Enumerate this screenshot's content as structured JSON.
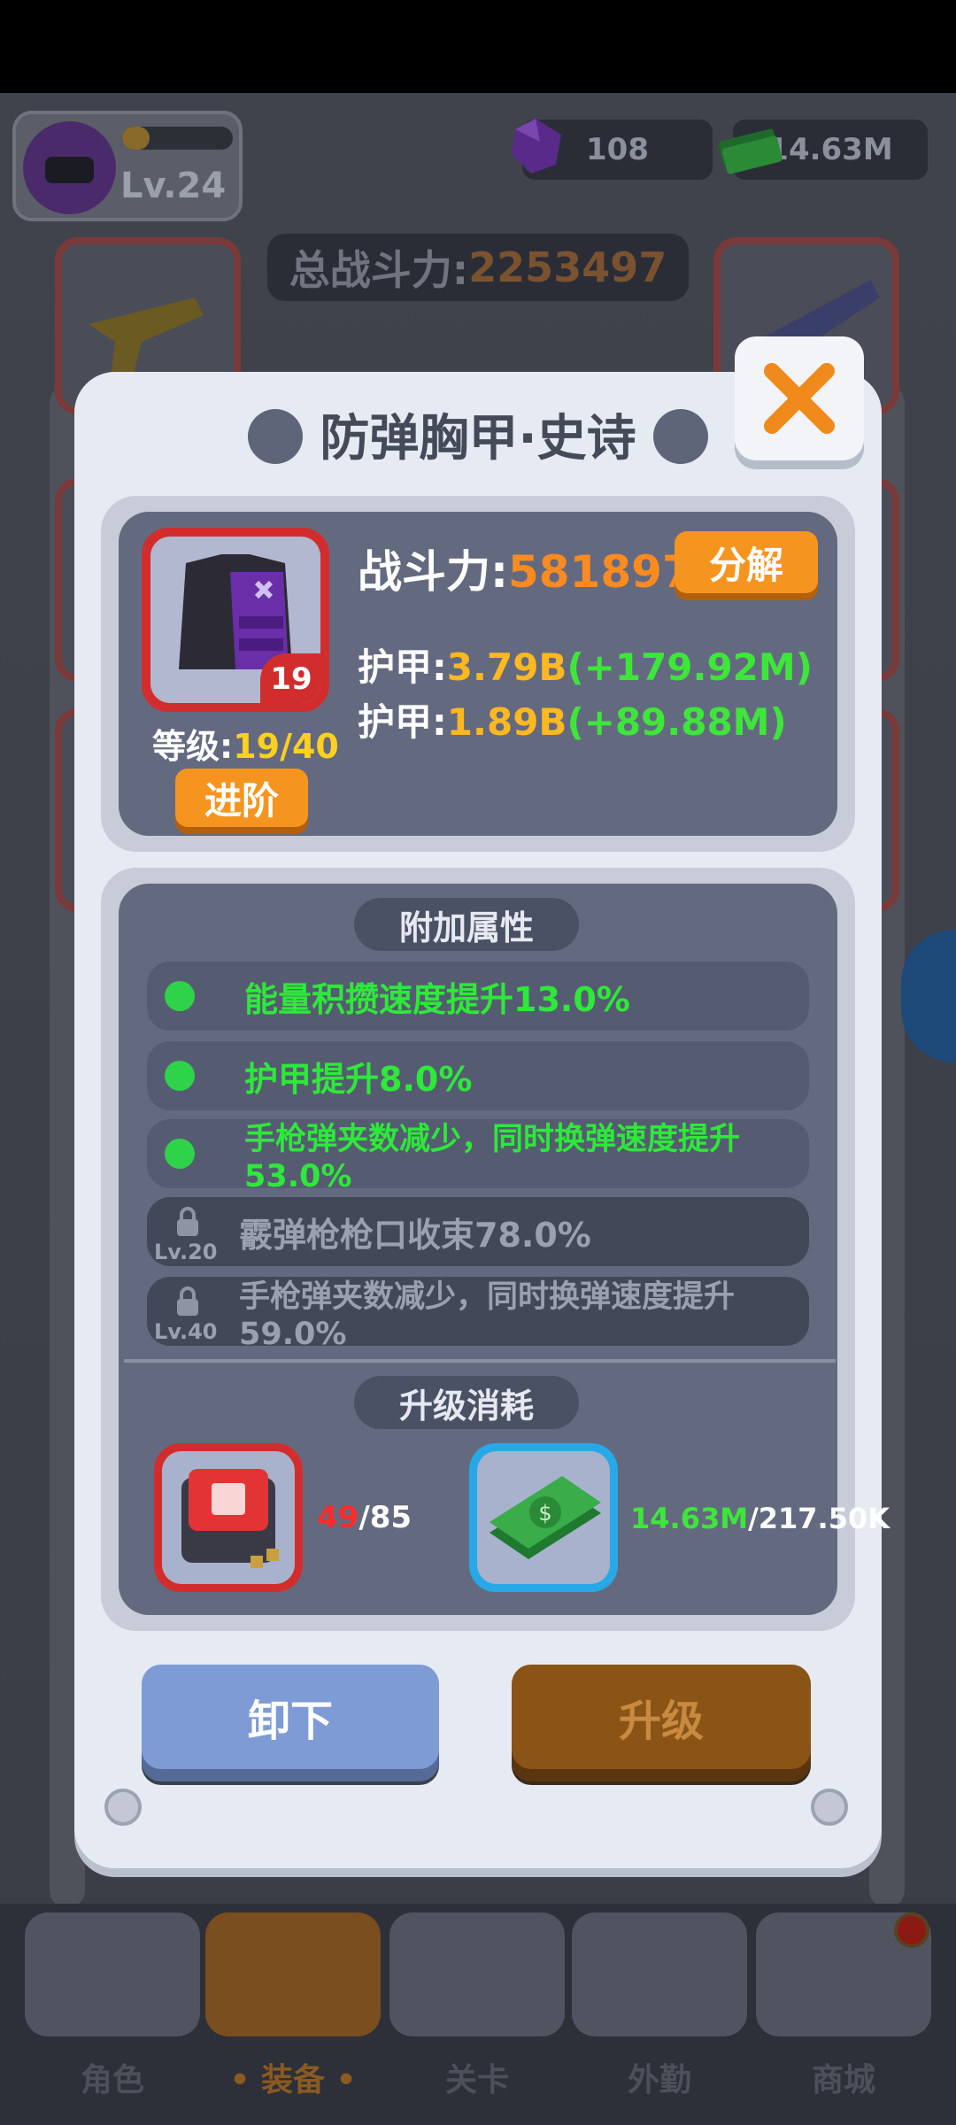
{
  "hud": {
    "level": "Lv.24",
    "xp_fraction": 0.25,
    "gems": "108",
    "cash": "14.63M",
    "total_power_label": "总战斗力:",
    "total_power_value": "2253497"
  },
  "modal": {
    "title": "防弹胸甲·史诗",
    "item": {
      "level_badge": "19",
      "grade_label": "等级:",
      "grade_value": "19/40",
      "advance_label": "进阶",
      "power_label": "战斗力:",
      "power_value": "581897",
      "disassemble_label": "分解",
      "stats": [
        {
          "label": "护甲:",
          "value": "3.79B",
          "bonus": "(+179.92M)"
        },
        {
          "label": "护甲:",
          "value": "1.89B",
          "bonus": "(+89.88M)"
        }
      ]
    },
    "extra_attrs": {
      "heading": "附加属性",
      "rows": [
        {
          "text": "能量积攒速度提升13.0%",
          "unlocked": true
        },
        {
          "text": "护甲提升8.0%",
          "unlocked": true
        },
        {
          "text": "手枪弹夹数减少，同时换弹速度提升53.0%",
          "unlocked": true
        },
        {
          "text": "霰弹枪枪口收束78.0%",
          "unlocked": false,
          "lock_level": "Lv.20"
        },
        {
          "text": "手枪弹夹数减少，同时换弹速度提升59.0%",
          "unlocked": false,
          "lock_level": "Lv.40"
        }
      ]
    },
    "upgrade_cost": {
      "heading": "升级消耗",
      "chip": {
        "have": "49",
        "need": "/85",
        "icon": "chip-icon"
      },
      "cash": {
        "have": "14.63M",
        "need": "/217.50K",
        "icon": "cash-stack-icon"
      }
    },
    "unequip_label": "卸下",
    "upgrade_label": "升级"
  },
  "nav": {
    "tabs": [
      {
        "label": "角色"
      },
      {
        "label": "• 装备 •"
      },
      {
        "label": "关卡"
      },
      {
        "label": "外勤"
      },
      {
        "label": "商城"
      }
    ]
  },
  "colors": {
    "accent_orange": "#f5951f",
    "bonus_green": "#3ee63a",
    "value_yellow": "#ffb820",
    "rarity_red": "#d22d2d",
    "cost_blue": "#27a9e8"
  }
}
